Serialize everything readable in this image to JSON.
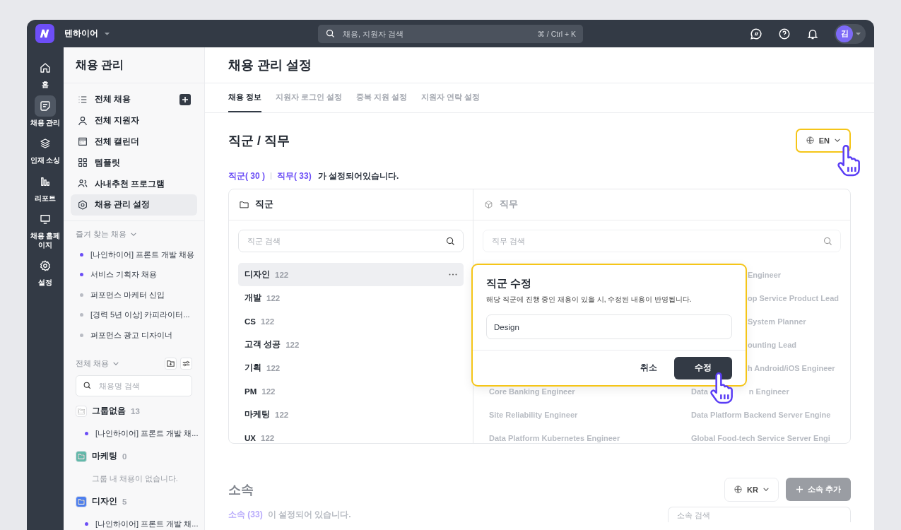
{
  "topbar": {
    "company": "텐하이어",
    "search": {
      "placeholder": "채용, 지원자 검색",
      "shortcut": "⌘ / Ctrl + K"
    },
    "avatar": "김"
  },
  "rail": {
    "items": [
      {
        "label": "홈",
        "selected": false
      },
      {
        "label": "채용 관리",
        "selected": true
      },
      {
        "label": "인재 소싱",
        "selected": false
      },
      {
        "label": "리포트",
        "selected": false
      },
      {
        "label": "채용 홈페이지",
        "selected": false
      },
      {
        "label": "설정",
        "selected": false
      }
    ]
  },
  "sidebar": {
    "title": "채용 관리",
    "nav": [
      {
        "label": "전체 채용",
        "selected": false,
        "add_button": true
      },
      {
        "label": "전체 지원자",
        "selected": false,
        "add_button": false
      },
      {
        "label": "전체 캘린더",
        "selected": false,
        "add_button": false
      },
      {
        "label": "템플릿",
        "selected": false,
        "add_button": false
      },
      {
        "label": "사내추천 프로그램",
        "selected": false,
        "add_button": false
      },
      {
        "label": "채용 관리 설정",
        "selected": true,
        "add_button": false
      }
    ],
    "favorites": {
      "title": "즐겨 찾는 채용",
      "items": [
        {
          "label": "[나인하이어] 프론트 개발 채용",
          "color": "#6b4ef6"
        },
        {
          "label": "서비스 기획자 채용",
          "color": "#6b4ef6"
        },
        {
          "label": "퍼포먼스 마케터 신입",
          "color": "#b9bcc4"
        },
        {
          "label": "[경력 5년 이상] 카피라이터...",
          "color": "#b9bcc4"
        },
        {
          "label": "퍼포먼스 광고 디자이너",
          "color": "#b9bcc4"
        }
      ]
    },
    "all": {
      "title": "전체 채용",
      "search": {
        "placeholder": "채용명 검색"
      },
      "groups": [
        {
          "name": "그룹없음",
          "count": "13",
          "color": "#ffffff",
          "items": [
            {
              "label": "[나인하이어] 프론트 개발 채...",
              "color": "#6b4ef6"
            }
          ]
        },
        {
          "name": "마케팅",
          "count": "0",
          "color": "#62b9aa",
          "empty": "그룹 내 채용이 없습니다."
        },
        {
          "name": "디자인",
          "count": "5",
          "color": "#4d7ff0",
          "items": [
            {
              "label": "[나인하이어] 프론트 개발 채...",
              "color": "#6b4ef6"
            }
          ]
        }
      ]
    }
  },
  "main": {
    "title": "채용 관리 설정",
    "tabs": [
      {
        "label": "채용 정보",
        "selected": true
      },
      {
        "label": "지원자 로그인 설정",
        "selected": false
      },
      {
        "label": "중복 지원 설정",
        "selected": false
      },
      {
        "label": "지원자 연락 설정",
        "selected": false
      }
    ],
    "section": {
      "title": "직군 / 직무",
      "language": {
        "label": "EN",
        "highlighted": true
      },
      "summary": {
        "counts": [
          "직군( 30 )",
          "직무( 33)"
        ],
        "text": "가 설정되어있습니다."
      },
      "categories": {
        "title": "직군",
        "search": {
          "placeholder": "직군 검색"
        },
        "items": [
          {
            "name": "디자인",
            "count": "122",
            "selected": true
          },
          {
            "name": "개발",
            "count": "122",
            "selected": false
          },
          {
            "name": "CS",
            "count": "122",
            "selected": false
          },
          {
            "name": "고객 성공",
            "count": "122",
            "selected": false
          },
          {
            "name": "기획",
            "count": "122",
            "selected": false
          },
          {
            "name": "PM",
            "count": "122",
            "selected": false
          },
          {
            "name": "마케팅",
            "count": "122",
            "selected": false
          },
          {
            "name": "UX",
            "count": "122",
            "selected": false
          }
        ]
      },
      "jobs": {
        "title": "직무",
        "dimmed": true,
        "search": {
          "placeholder": "직무 검색"
        },
        "rows": [
          {
            "column_2": [
              "Engineer"
            ]
          },
          {
            "column_2": [
              "op Service Product Lead"
            ]
          },
          {
            "column_2": [
              "System Planner"
            ]
          },
          {
            "column_2": [
              "ounting Lead"
            ]
          },
          {
            "column_2": [
              "h Android/iOS Engineer"
            ]
          },
          {
            "column_1": "Core Banking Engineer",
            "column_2": [
              "Data",
              "n Engineer"
            ]
          },
          {
            "column_1": "Site Reliability Engineer",
            "column_2": [
              "Data Platform Backend Server Engine"
            ]
          },
          {
            "column_1": "Data Platform Kubernetes Engineer",
            "column_2": [
              "Global Food-tech Service Server Engi"
            ]
          }
        ]
      }
    },
    "dialog": {
      "title": "직군 수정",
      "description": "해당 직군에 진행 중인 채용이 있을 시, 수정된 내용이 반영됩니다.",
      "value": "Design",
      "highlighted": true,
      "buttons": [
        {
          "label": "취소",
          "kind": "text"
        },
        {
          "label": "수정",
          "kind": "primary"
        }
      ]
    },
    "affiliation": {
      "title": "소속",
      "dimmed": true,
      "language": {
        "label": "KR",
        "highlighted": false
      },
      "add_button": {
        "label": "소속 추가",
        "disabled": true
      },
      "summary": {
        "count": "소속 (33)",
        "text": "이 설정되어 있습니다."
      },
      "search": {
        "placeholder": "소속 검색"
      }
    }
  }
}
